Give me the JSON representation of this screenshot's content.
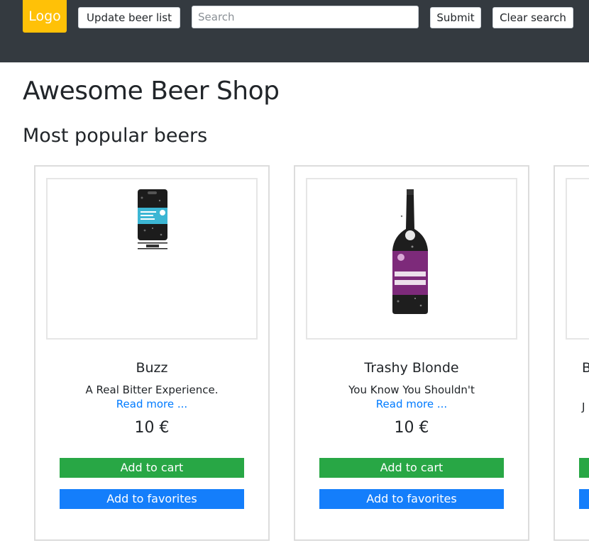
{
  "navbar": {
    "logo_text": "Logo",
    "update_label": "Update beer list",
    "search_placeholder": "Search",
    "submit_label": "Submit",
    "clear_label": "Clear search"
  },
  "page": {
    "title": "Awesome Beer Shop",
    "section_title": "Most popular beers"
  },
  "beers": [
    {
      "name": "Buzz",
      "tagline": "A Real Bitter Experience.",
      "read_more": "Read more ...",
      "price": "10 €",
      "cart_label": "Add to cart",
      "favorites_label": "Add to favorites",
      "image": "keg-icon"
    },
    {
      "name": "Trashy Blonde",
      "tagline": "You Know You Shouldn't",
      "read_more": "Read more ...",
      "price": "10 €",
      "cart_label": "Add to cart",
      "favorites_label": "Add to favorites",
      "image": "bottle-icon"
    },
    {
      "name": "B",
      "tagline": "J",
      "read_more": "",
      "price": "",
      "cart_label": "",
      "favorites_label": ""
    }
  ],
  "colors": {
    "navbar": "#343a40",
    "logo": "#ffc107",
    "cart_button": "#28a745",
    "favorites_button": "#147efb",
    "link": "#007bff"
  }
}
